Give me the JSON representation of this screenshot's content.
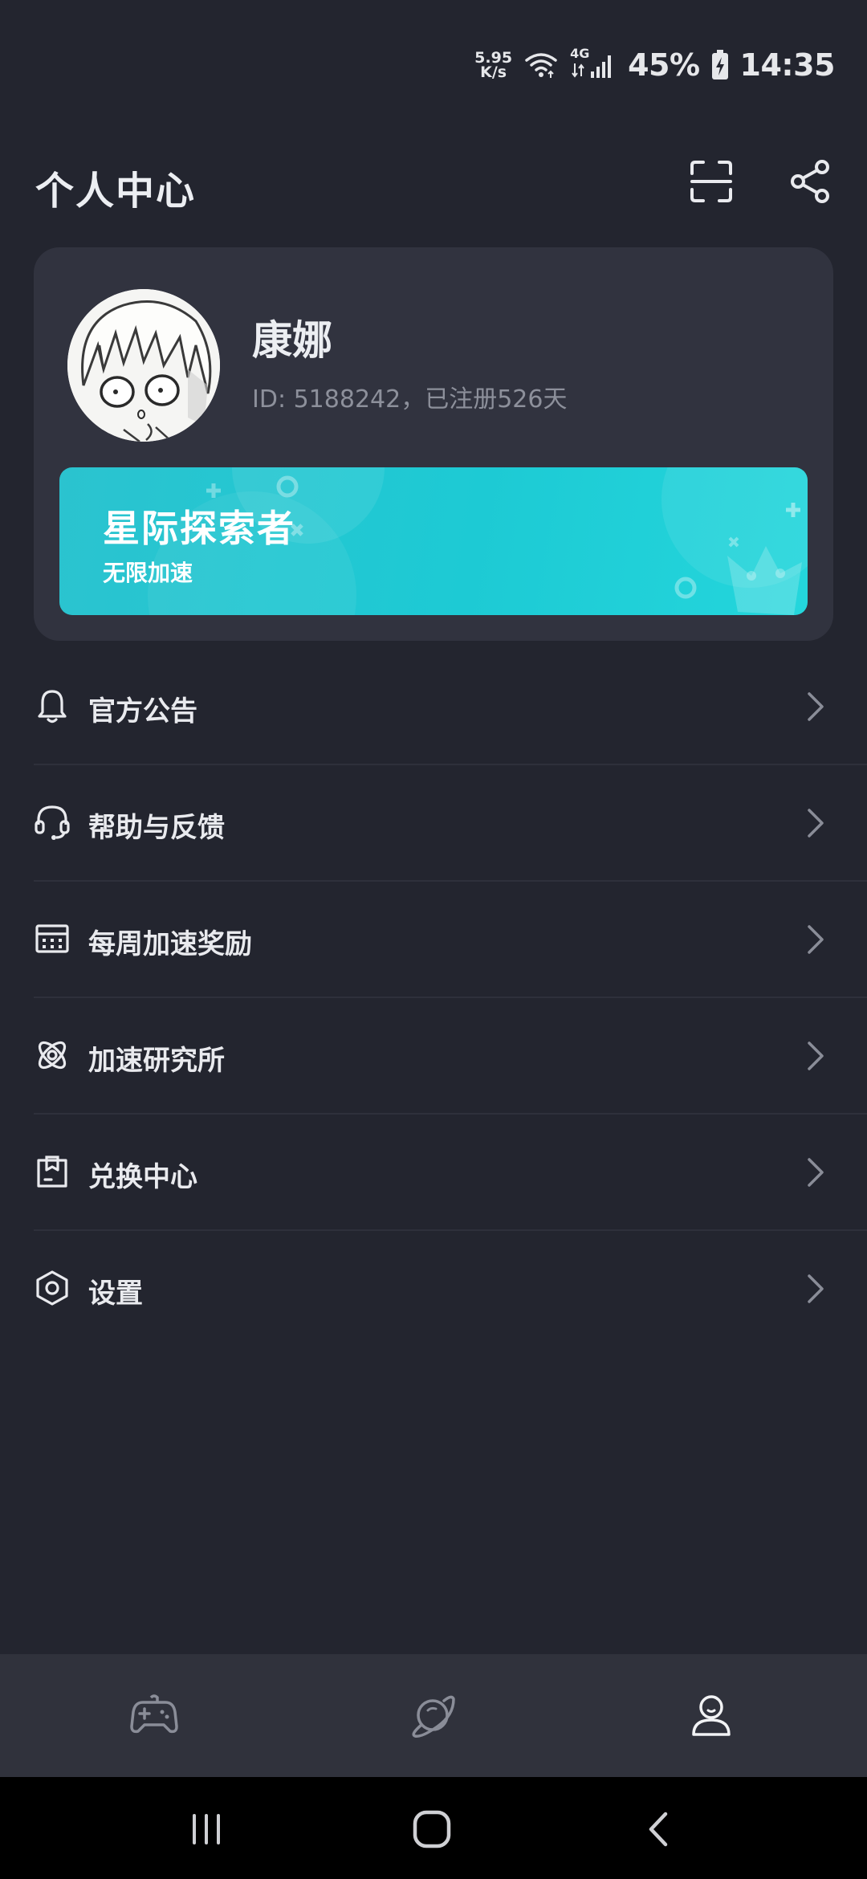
{
  "status_bar": {
    "net_speed_value": "5.95",
    "net_speed_unit": "K/s",
    "network_type": "4G",
    "battery": "45%",
    "time": "14:35",
    "icons": [
      "wifi-icon",
      "signal-icon",
      "battery-charging-icon"
    ]
  },
  "header": {
    "title": "个人中心",
    "actions": [
      "scan-icon",
      "share-icon"
    ]
  },
  "profile": {
    "name": "康娜",
    "id_line": "ID: 5188242，已注册526天"
  },
  "vip": {
    "title": "星际探索者",
    "subtitle": "无限加速",
    "accent": "#1dcad4"
  },
  "menu": {
    "items": [
      {
        "label": "官方公告",
        "icon": "bell-icon"
      },
      {
        "label": "帮助与反馈",
        "icon": "headset-icon"
      },
      {
        "label": "每周加速奖励",
        "icon": "calendar-icon"
      },
      {
        "label": "加速研究所",
        "icon": "atom-icon"
      },
      {
        "label": "兑换中心",
        "icon": "gift-box-icon"
      },
      {
        "label": "设置",
        "icon": "settings-hex-icon"
      }
    ]
  },
  "tabs": [
    {
      "icon": "gamepad-icon",
      "active": false
    },
    {
      "icon": "planet-icon",
      "active": false
    },
    {
      "icon": "user-icon",
      "active": true
    }
  ],
  "colors": {
    "background": "#23252f",
    "card": "#31333f",
    "tab_bar": "#30323c",
    "active_tab": "#f2f3f5",
    "inactive_tab": "#8a8d98"
  }
}
